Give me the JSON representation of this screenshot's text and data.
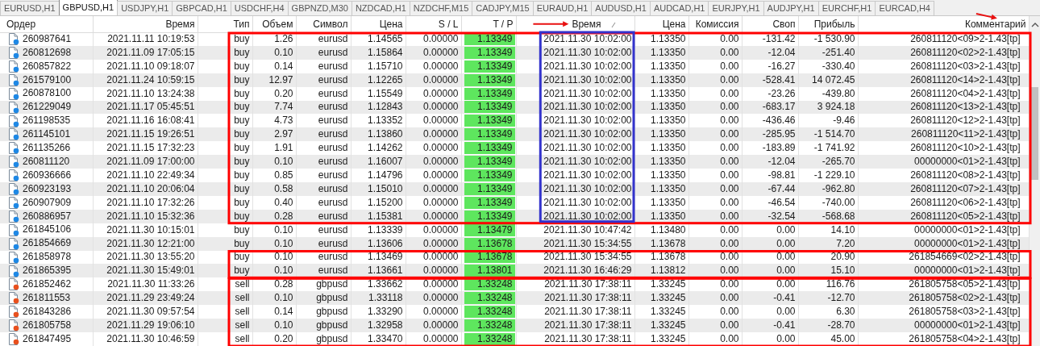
{
  "tabs": [
    {
      "label": "EURUSD,H1",
      "selected": false
    },
    {
      "label": "GBPUSD,H1",
      "selected": true
    },
    {
      "label": "USDJPY,H1",
      "selected": false
    },
    {
      "label": "GBPCAD,H1",
      "selected": false
    },
    {
      "label": "USDCHF,H4",
      "selected": false
    },
    {
      "label": "GBPNZD,M30",
      "selected": false
    },
    {
      "label": "NZDCAD,H1",
      "selected": false
    },
    {
      "label": "NZDCHF,M15",
      "selected": false
    },
    {
      "label": "CADJPY,M15",
      "selected": false
    },
    {
      "label": "EURAUD,H1",
      "selected": false
    },
    {
      "label": "AUDUSD,H1",
      "selected": false
    },
    {
      "label": "AUDCAD,H1",
      "selected": false
    },
    {
      "label": "EURJPY,H1",
      "selected": false
    },
    {
      "label": "AUDJPY,H1",
      "selected": false
    },
    {
      "label": "EURCHF,H1",
      "selected": false
    },
    {
      "label": "EURCAD,H4",
      "selected": false
    }
  ],
  "table": {
    "columns": [
      {
        "label": "Ордер"
      },
      {
        "label": "Время"
      },
      {
        "label": "Тип"
      },
      {
        "label": "Объем"
      },
      {
        "label": "Символ"
      },
      {
        "label": "Цена"
      },
      {
        "label": "S / L"
      },
      {
        "label": "T / P"
      },
      {
        "label": "Время",
        "sorted": true,
        "arrow": {
          "kind": "level"
        }
      },
      {
        "label": "Цена"
      },
      {
        "label": "Комиссия"
      },
      {
        "label": "Своп"
      },
      {
        "label": "Прибыль"
      },
      {
        "label": "Комментарий",
        "arrow": {
          "kind": "slanted"
        }
      }
    ],
    "row_groups": [
      {
        "color": "#ff0000",
        "column_outline": {
          "color": "#3333cc"
        },
        "rows": [
          {
            "color": "#1e88e5",
            "cells": [
              "260987641",
              "2021.11.11 10:19:53",
              "buy",
              "1.26",
              "eurusd",
              "1.14565",
              "0.00000",
              "1.13349",
              "2021.11.30 10:02:00",
              "1.13350",
              "0.00",
              "-131.42",
              "-1 530.90",
              "260811120<09>2-1.43[tp]"
            ]
          },
          {
            "color": "#1e88e5",
            "cells": [
              "260812698",
              "2021.11.09 17:05:15",
              "buy",
              "0.10",
              "eurusd",
              "1.15864",
              "0.00000",
              "1.13349",
              "2021.11.30 10:02:00",
              "1.13350",
              "0.00",
              "-12.04",
              "-251.40",
              "260811120<02>2-1.43[tp]"
            ]
          },
          {
            "color": "#1e88e5",
            "cells": [
              "260857822",
              "2021.11.10 09:18:07",
              "buy",
              "0.14",
              "eurusd",
              "1.15710",
              "0.00000",
              "1.13349",
              "2021.11.30 10:02:00",
              "1.13350",
              "0.00",
              "-16.27",
              "-330.40",
              "260811120<03>2-1.43[tp]"
            ]
          },
          {
            "color": "#1e88e5",
            "cells": [
              "261579100",
              "2021.11.24 10:59:15",
              "buy",
              "12.97",
              "eurusd",
              "1.12265",
              "0.00000",
              "1.13349",
              "2021.11.30 10:02:00",
              "1.13350",
              "0.00",
              "-528.41",
              "14 072.45",
              "260811120<14>2-1.43[tp]"
            ]
          },
          {
            "color": "#1e88e5",
            "cells": [
              "260878100",
              "2021.11.10 13:24:38",
              "buy",
              "0.20",
              "eurusd",
              "1.15549",
              "0.00000",
              "1.13349",
              "2021.11.30 10:02:00",
              "1.13350",
              "0.00",
              "-23.26",
              "-439.80",
              "260811120<04>2-1.43[tp]"
            ]
          },
          {
            "color": "#1e88e5",
            "cells": [
              "261229049",
              "2021.11.17 05:45:51",
              "buy",
              "7.74",
              "eurusd",
              "1.12843",
              "0.00000",
              "1.13349",
              "2021.11.30 10:02:00",
              "1.13350",
              "0.00",
              "-683.17",
              "3 924.18",
              "260811120<13>2-1.43[tp]"
            ]
          },
          {
            "color": "#1e88e5",
            "cells": [
              "261198535",
              "2021.11.16 16:08:41",
              "buy",
              "4.73",
              "eurusd",
              "1.13352",
              "0.00000",
              "1.13349",
              "2021.11.30 10:02:00",
              "1.13350",
              "0.00",
              "-436.46",
              "-9.46",
              "260811120<12>2-1.43[tp]"
            ]
          },
          {
            "color": "#1e88e5",
            "cells": [
              "261145101",
              "2021.11.15 19:26:51",
              "buy",
              "2.97",
              "eurusd",
              "1.13860",
              "0.00000",
              "1.13349",
              "2021.11.30 10:02:00",
              "1.13350",
              "0.00",
              "-285.95",
              "-1 514.70",
              "260811120<11>2-1.43[tp]"
            ]
          },
          {
            "color": "#1e88e5",
            "cells": [
              "261135266",
              "2021.11.15 17:32:23",
              "buy",
              "1.91",
              "eurusd",
              "1.14262",
              "0.00000",
              "1.13349",
              "2021.11.30 10:02:00",
              "1.13350",
              "0.00",
              "-183.89",
              "-1 741.92",
              "260811120<10>2-1.43[tp]"
            ]
          },
          {
            "color": "#1e88e5",
            "cells": [
              "260811120",
              "2021.11.09 17:00:00",
              "buy",
              "0.10",
              "eurusd",
              "1.16007",
              "0.00000",
              "1.13349",
              "2021.11.30 10:02:00",
              "1.13350",
              "0.00",
              "-12.04",
              "-265.70",
              "00000000<01>2-1.43[tp]"
            ]
          },
          {
            "color": "#1e88e5",
            "cells": [
              "260936666",
              "2021.11.10 22:49:34",
              "buy",
              "0.85",
              "eurusd",
              "1.14796",
              "0.00000",
              "1.13349",
              "2021.11.30 10:02:00",
              "1.13350",
              "0.00",
              "-98.81",
              "-1 229.10",
              "260811120<08>2-1.43[tp]"
            ]
          },
          {
            "color": "#1e88e5",
            "cells": [
              "260923193",
              "2021.11.10 20:06:04",
              "buy",
              "0.58",
              "eurusd",
              "1.15010",
              "0.00000",
              "1.13349",
              "2021.11.30 10:02:00",
              "1.13350",
              "0.00",
              "-67.44",
              "-962.80",
              "260811120<07>2-1.43[tp]"
            ]
          },
          {
            "color": "#1e88e5",
            "cells": [
              "260907909",
              "2021.11.10 17:32:26",
              "buy",
              "0.40",
              "eurusd",
              "1.15200",
              "0.00000",
              "1.13349",
              "2021.11.30 10:02:00",
              "1.13350",
              "0.00",
              "-46.54",
              "-740.00",
              "260811120<06>2-1.43[tp]"
            ]
          },
          {
            "color": "#1e88e5",
            "cells": [
              "260886957",
              "2021.11.10 15:32:36",
              "buy",
              "0.28",
              "eurusd",
              "1.15381",
              "0.00000",
              "1.13349",
              "2021.11.30 10:02:00",
              "1.13350",
              "0.00",
              "-32.54",
              "-568.68",
              "260811120<05>2-1.43[tp]"
            ]
          }
        ]
      },
      {
        "rows": [
          {
            "color": "#1e88e5",
            "cells": [
              "261845106",
              "2021.11.30 10:15:01",
              "buy",
              "0.10",
              "eurusd",
              "1.13339",
              "0.00000",
              "1.13479",
              "2021.11.30 10:47:42",
              "1.13480",
              "0.00",
              "0.00",
              "14.10",
              "00000000<01>2-1.43[tp]"
            ]
          },
          {
            "color": "#1e88e5",
            "cells": [
              "261854669",
              "2021.11.30 12:21:00",
              "buy",
              "0.10",
              "eurusd",
              "1.13606",
              "0.00000",
              "1.13678",
              "2021.11.30 15:34:55",
              "1.13678",
              "0.00",
              "0.00",
              "7.20",
              "00000000<01>2-1.43[tp]"
            ]
          }
        ]
      },
      {
        "color": "#ff0000",
        "rows": [
          {
            "color": "#1e88e5",
            "cells": [
              "261858978",
              "2021.11.30 13:55:20",
              "buy",
              "0.10",
              "eurusd",
              "1.13469",
              "0.00000",
              "1.13678",
              "2021.11.30 15:34:55",
              "1.13678",
              "0.00",
              "0.00",
              "20.90",
              "261854669<02>2-1.43[tp]"
            ]
          },
          {
            "color": "#1e88e5",
            "cells": [
              "261865395",
              "2021.11.30 15:49:01",
              "buy",
              "0.10",
              "eurusd",
              "1.13661",
              "0.00000",
              "1.13801",
              "2021.11.30 16:46:29",
              "1.13812",
              "0.00",
              "0.00",
              "15.10",
              "00000000<01>2-1.43[tp]"
            ]
          }
        ]
      },
      {
        "color": "#ff0000",
        "rows": [
          {
            "color": "#e8501e",
            "cells": [
              "261852462",
              "2021.11.30 11:33:26",
              "sell",
              "0.28",
              "gbpusd",
              "1.33662",
              "0.00000",
              "1.33248",
              "2021.11.30 17:38:11",
              "1.33245",
              "0.00",
              "0.00",
              "116.76",
              "261805758<05>2-1.43[tp]"
            ]
          },
          {
            "color": "#e8501e",
            "cells": [
              "261811553",
              "2021.11.29 23:49:24",
              "sell",
              "0.10",
              "gbpusd",
              "1.33118",
              "0.00000",
              "1.33248",
              "2021.11.30 17:38:11",
              "1.33245",
              "0.00",
              "-0.41",
              "-12.70",
              "261805758<02>2-1.43[tp]"
            ]
          },
          {
            "color": "#e8501e",
            "cells": [
              "261843286",
              "2021.11.30 09:57:54",
              "sell",
              "0.14",
              "gbpusd",
              "1.33290",
              "0.00000",
              "1.33248",
              "2021.11.30 17:38:11",
              "1.33245",
              "0.00",
              "0.00",
              "6.30",
              "261805758<03>2-1.43[tp]"
            ]
          },
          {
            "color": "#e8501e",
            "cells": [
              "261805758",
              "2021.11.29 19:06:10",
              "sell",
              "0.10",
              "gbpusd",
              "1.32958",
              "0.00000",
              "1.33248",
              "2021.11.30 17:38:11",
              "1.33245",
              "0.00",
              "-0.41",
              "-28.70",
              "00000000<01>2-1.43[tp]"
            ]
          },
          {
            "color": "#e8501e",
            "cells": [
              "261847495",
              "2021.11.30 10:46:59",
              "sell",
              "0.20",
              "gbpusd",
              "1.33470",
              "0.00000",
              "1.33248",
              "2021.11.30 17:38:11",
              "1.33245",
              "0.00",
              "0.00",
              "45.00",
              "261805758<04>2-1.43[tp]"
            ]
          }
        ]
      }
    ]
  }
}
